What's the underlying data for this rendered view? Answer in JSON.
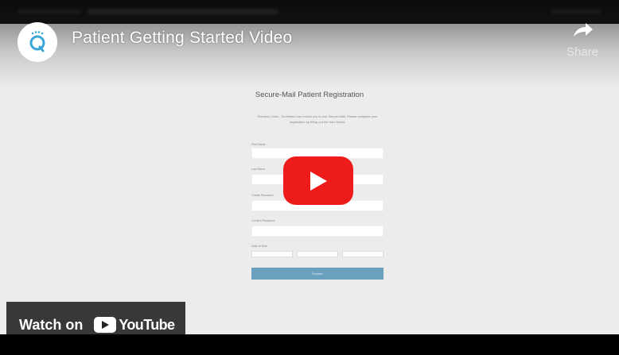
{
  "video": {
    "title": "Patient Getting Started Video",
    "share_label": "Share",
    "watch_on_label": "Watch on",
    "youtube_wordmark": "YouTube"
  },
  "form": {
    "title": "Secure-Mail Patient Registration",
    "intro": "Rainbow Clinic - Southland has invited you to use Secure-Mail. Please complete your registration by filling out the form below.",
    "fields": [
      "First Name",
      "Last Name",
      "Create Password",
      "Confirm Password"
    ],
    "dob_label": "Date of Birth",
    "register_label": "Register"
  },
  "colors": {
    "play_red": "#ee1b1b",
    "register_blue": "#6aa0bd",
    "avatar_blue": "#3aa6d8"
  }
}
